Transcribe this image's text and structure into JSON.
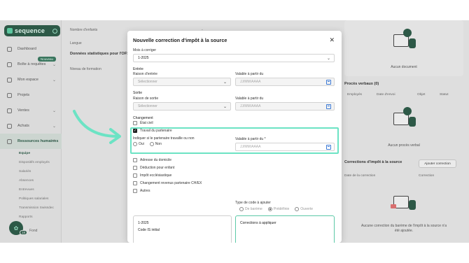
{
  "sidebar": {
    "logo": "sequence",
    "items": [
      {
        "label": "Dashboard"
      },
      {
        "label": "Boîte à requêtes",
        "badge": "Nouveau"
      },
      {
        "label": "Mon espace"
      },
      {
        "label": "Projets"
      },
      {
        "label": "Ventes"
      },
      {
        "label": "Achats"
      },
      {
        "label": "Ressources humaines"
      }
    ],
    "subitems": [
      "Equipe",
      "Dispositifs employés",
      "Salariés",
      "Absences",
      "Entrevues",
      "Politiques salariales",
      "Transmission Swissdec",
      "Rapports"
    ],
    "bottom_badge": "18",
    "bottom_label": "Fond"
  },
  "background": {
    "nombre_enfants": "Nombre d'enfants",
    "nombre_value": "-",
    "langue": "Langue",
    "stats_title": "Données statistiques pour l'OFS",
    "niveau": "Niveau de formation",
    "aucun_document": "Aucun document",
    "proces_title": "Procès verbaux (0)",
    "cols": [
      "Employés",
      "Date d'envoi",
      "Objet",
      "Statut"
    ],
    "aucun_proces": "Aucun procès verbal",
    "corrections_title": "Corrections d'impôt à la source",
    "ajouter_btn": "Ajouter correction",
    "date_col": "Date de la correction",
    "correction_col": "Correction",
    "aucune_correction": "Aucune correction du barème de l'impôt à la source n'a été ajoutée."
  },
  "modal": {
    "title": "Nouvelle correction d'impôt à la source",
    "mois_label": "Mois à corriger",
    "mois_value": "1-2025",
    "entree_section": "Entrée",
    "raison_entree_label": "Raison d'entrée",
    "select_placeholder": "Sélectionner",
    "valable_label": "Valable à partir du",
    "date_placeholder": "JJ/MM/AAAA",
    "sortie_section": "Sortie",
    "raison_sortie_label": "Raison de sortie",
    "changement_section": "Changement",
    "etat_civil": "État civil",
    "travail_partenaire": "Travail du partenaire",
    "indiquer_label": "Indiquer si le partenaire travaille ou non",
    "oui": "Oui",
    "non": "Non",
    "valable_required_label": "Valable à partir du *",
    "adresse": "Adresse du domicile",
    "deduction": "Déduction pour enfant",
    "impot_eccl": "Impôt ecclésiastique",
    "changement_revenu": "Changement revenus partenaire CH/EX",
    "autres": "Autres",
    "type_code_label": "Type de code à ajouter",
    "type_options": [
      "De barème",
      "Prédéfinie",
      "Ouverte"
    ],
    "box_month": "1-2025",
    "code_is_initial": "Code IS initial",
    "corrections_a_appliquer": "Corrections à appliquer"
  },
  "colors": {
    "accent": "#6ce3c4",
    "brand": "#2c5c48"
  }
}
